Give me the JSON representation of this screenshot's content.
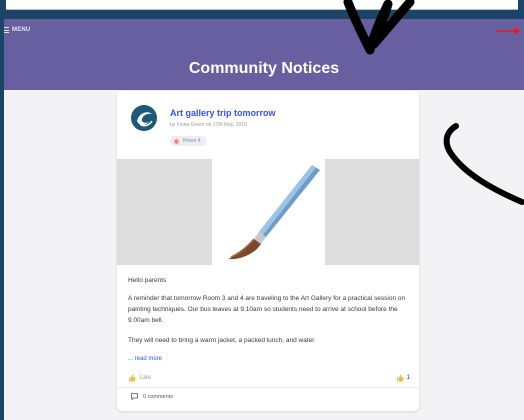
{
  "header": {
    "menu_label": "MENU",
    "title": "Community Notices"
  },
  "post": {
    "title": "Art gallery trip tomorrow",
    "meta": "by Fiona Green on 17th May, 2019",
    "tag": "Room 4",
    "greeting": "Hello parents",
    "paragraph1": "A reminder that tomorrow Room 3 and 4 are traveling to the Art Gallery for a practical session on painting techniques. Our bus leaves at 9.10am so students need to arrive at school before the 9.00am bell.",
    "paragraph2": "They will need to bring a warm jacket, a packed lunch, and water",
    "read_more": "... read more",
    "like_label": "Like",
    "like_count": "1",
    "comments_label": "0 comments"
  },
  "colors": {
    "frame": "#1c4466",
    "header": "#675f9f",
    "accent": "#3553d6",
    "annotation_red": "#e02020"
  },
  "icons": {
    "menu": "hamburger-icon",
    "avatar": "school-logo-icon",
    "tag": "tag-icon",
    "like": "thumbs-up-icon",
    "comments": "comment-icon"
  }
}
